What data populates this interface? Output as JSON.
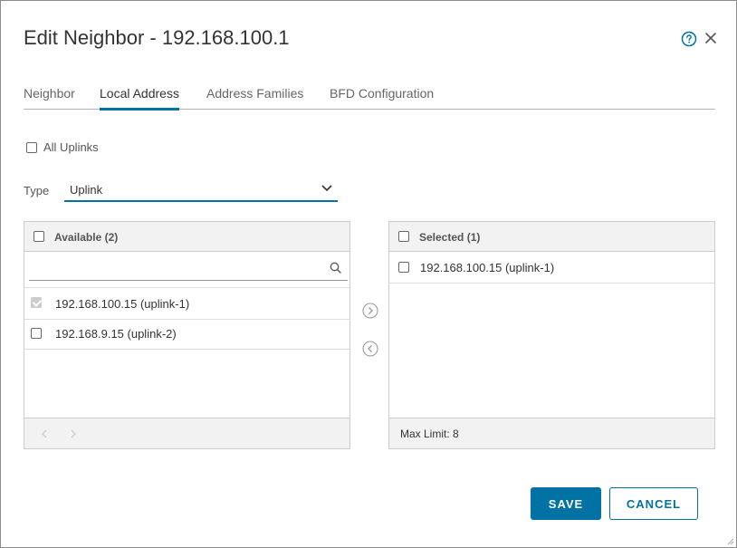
{
  "dialog": {
    "title": "Edit Neighbor - 192.168.100.1",
    "help_icon": "help-circle-icon",
    "close_icon": "close-icon"
  },
  "tabs": [
    {
      "label": "Neighbor",
      "active": false
    },
    {
      "label": "Local Address",
      "active": true
    },
    {
      "label": "Address Families",
      "active": false
    },
    {
      "label": "BFD Configuration",
      "active": false
    }
  ],
  "all_uplinks": {
    "label": "All Uplinks",
    "checked": false
  },
  "type": {
    "label": "Type",
    "value": "Uplink"
  },
  "available": {
    "header": "Available (2)",
    "search": {
      "value": "",
      "placeholder": ""
    },
    "items": [
      {
        "label": "192.168.100.15 (uplink-1)",
        "checked": true,
        "disabled": true
      },
      {
        "label": "192.168.9.15 (uplink-2)",
        "checked": false,
        "disabled": false
      }
    ]
  },
  "selected": {
    "header": "Selected (1)",
    "items": [
      {
        "label": "192.168.100.15 (uplink-1)",
        "checked": false
      }
    ],
    "footer": "Max Limit: 8"
  },
  "buttons": {
    "save": "SAVE",
    "cancel": "CANCEL"
  },
  "colors": {
    "accent": "#0072a3",
    "border": "#cccccc",
    "panel_header": "#f2f2f2"
  }
}
